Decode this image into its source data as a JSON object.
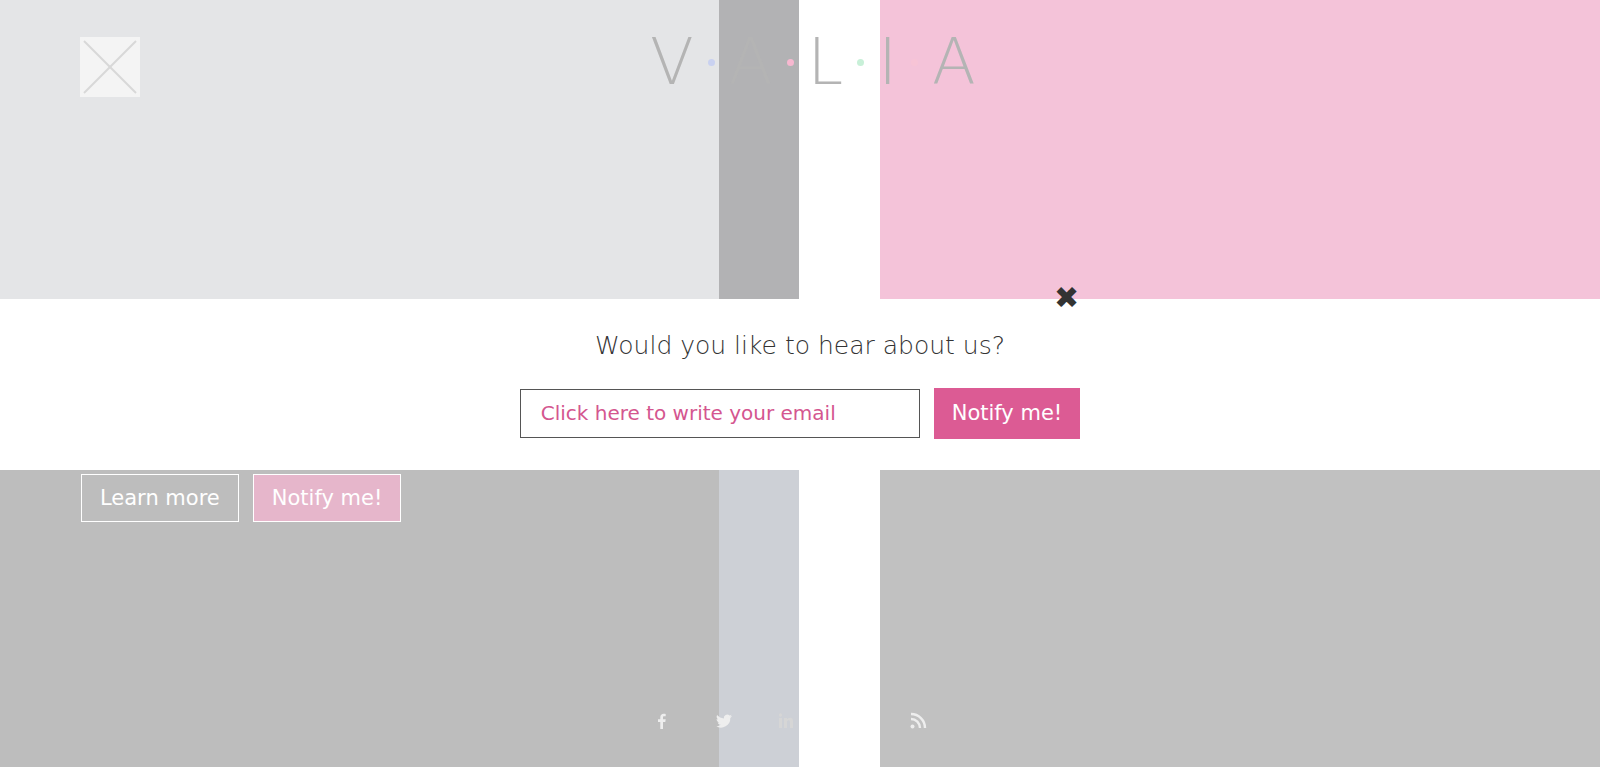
{
  "logo": {
    "letters": [
      "V",
      "A",
      "L",
      "I",
      "A"
    ],
    "dots": [
      {
        "color": "#c9d1f0"
      },
      {
        "color": "#f7b8d0"
      },
      {
        "color": "#c8f0d8"
      },
      {
        "color": "#f7c4d6"
      }
    ]
  },
  "hero_buttons": [
    {
      "label": "Learn more",
      "kind": "outline"
    },
    {
      "label": "Notify me!",
      "kind": "filled"
    }
  ],
  "modal": {
    "close": "✖",
    "title": "Would you like to hear about us?",
    "email_placeholder": "Click here to write your email",
    "submit": "Notify me!"
  }
}
